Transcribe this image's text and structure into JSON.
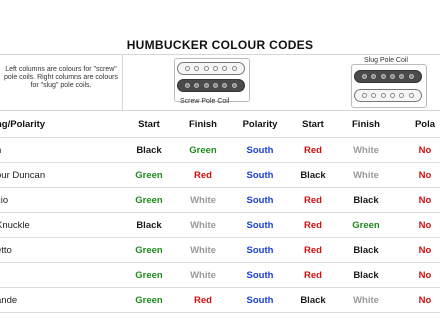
{
  "title": "HUMBUCKER COLOUR CODES",
  "note": "Left columns are colours for \"screw\" pole coils. Right columns are colours for \"slug\" pole coils.",
  "screw_coil_label": "Screw Pole Coil",
  "slug_coil_label": "Slug Pole Coil",
  "columns": [
    "ng/Polarity",
    "Start",
    "Finish",
    "Polarity",
    "Start",
    "Finish",
    "Pola"
  ],
  "rows": [
    {
      "name": "n",
      "s_start": "Black",
      "s_finish": "Green",
      "s_pol": "South",
      "g_start": "Red",
      "g_finish": "White",
      "g_pol": "No"
    },
    {
      "name": "our Duncan",
      "s_start": "Green",
      "s_finish": "Red",
      "s_pol": "South",
      "g_start": "Black",
      "g_finish": "White",
      "g_pol": "No"
    },
    {
      "name": "zio",
      "s_start": "Green",
      "s_finish": "White",
      "s_pol": "South",
      "g_start": "Red",
      "g_finish": "Black",
      "g_pol": "No"
    },
    {
      "name": "Knuckle",
      "s_start": "Black",
      "s_finish": "White",
      "s_pol": "South",
      "g_start": "Red",
      "g_finish": "Green",
      "g_pol": "No"
    },
    {
      "name": "etto",
      "s_start": "Green",
      "s_finish": "White",
      "s_pol": "South",
      "g_start": "Red",
      "g_finish": "Black",
      "g_pol": "No"
    },
    {
      "name": "",
      "s_start": "Green",
      "s_finish": "White",
      "s_pol": "South",
      "g_start": "Red",
      "g_finish": "Black",
      "g_pol": "No"
    },
    {
      "name": "ande",
      "s_start": "Green",
      "s_finish": "Red",
      "s_pol": "South",
      "g_start": "Black",
      "g_finish": "White",
      "g_pol": "No"
    }
  ],
  "colors": {
    "Black": "#1a1a1a",
    "Green": "#1f8b1f",
    "Red": "#d01010",
    "White": "#9a9a9a",
    "South": "#1a3fd6",
    "North": "#d01010"
  }
}
